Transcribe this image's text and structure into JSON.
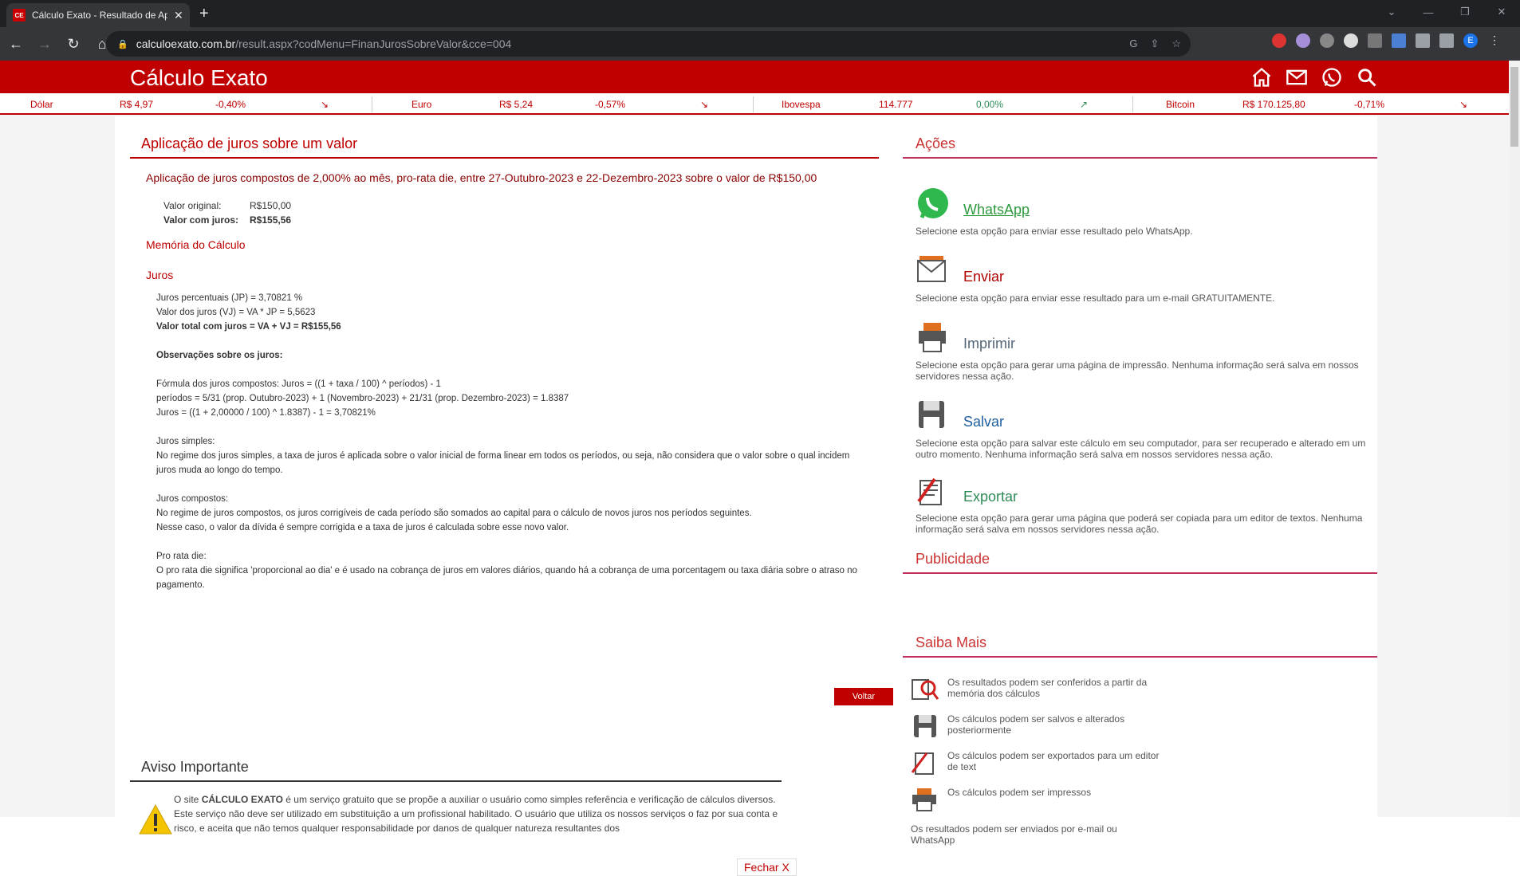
{
  "browser": {
    "tab_title": "Cálculo Exato - Resultado de Ap",
    "favicon_text": "CE",
    "url_host": "calculoexato.com.br",
    "url_path": "/result.aspx?codMenu=FinanJurosSobreValor&cce=004",
    "avatar_letter": "E"
  },
  "header": {
    "logo": "Cálculo Exato"
  },
  "ticker": [
    {
      "name": "Dólar",
      "price": "R$ 4,97",
      "change": "-0,40%",
      "trend": "down"
    },
    {
      "name": "Euro",
      "price": "R$ 5,24",
      "change": "-0,57%",
      "trend": "down"
    },
    {
      "name": "Ibovespa",
      "price": "114.777",
      "change": "0,00%",
      "trend": "up"
    },
    {
      "name": "Bitcoin",
      "price": "R$ 170.125,80",
      "change": "-0,71%",
      "trend": "down"
    }
  ],
  "main": {
    "title": "Aplicação de juros sobre um valor",
    "subtitle": "Aplicação de juros compostos de 2,000% ao mês, pro-rata die, entre 27-Outubro-2023 e 22-Dezembro-2023 sobre o valor de R$150,00",
    "valor_original_label": "Valor original:",
    "valor_original": "R$150,00",
    "valor_juros_label": "Valor com juros:",
    "valor_juros": "R$155,56",
    "memoria": "Memória do Cálculo",
    "juros_heading": "Juros",
    "lines": {
      "l1": "Juros percentuais (JP)  =  3,70821 %",
      "l2": "Valor dos juros (VJ)  =  VA * JP  =  5,5623",
      "l3": "Valor total com juros  =  VA + VJ  =  R$155,56",
      "obs": "Observações sobre os juros:",
      "f1": "Fórmula dos juros compostos: Juros = ((1 + taxa / 100) ^ períodos) - 1",
      "f2": "períodos = 5/31 (prop. Outubro-2023) + 1 (Novembro-2023) + 21/31 (prop. Dezembro-2023) = 1.8387",
      "f3": "Juros = ((1 + 2,00000 / 100) ^ 1.8387) - 1 = 3,70821%",
      "s_title": "Juros simples:",
      "s_body": "No regime dos juros simples, a taxa de juros é aplicada sobre o valor inicial de forma linear em todos os períodos, ou seja, não considera que o valor sobre o qual incidem juros muda ao longo do tempo.",
      "c_title": "Juros compostos:",
      "c_body1": "No regime de juros compostos, os juros corrigíveis de cada período são somados ao capital para o cálculo de novos juros nos períodos seguintes.",
      "c_body2": "Nesse caso, o valor da dívida é sempre corrigida e a taxa de juros é calculada sobre esse novo valor.",
      "p_title": "Pro rata die:",
      "p_body": "O pro rata die significa 'proporcional ao dia' e é usado na cobrança de juros em valores diários, quando há a cobrança de uma porcentagem ou taxa diária sobre o atraso no pagamento."
    },
    "voltar": "Voltar",
    "aviso_title": "Aviso Importante",
    "aviso_body_pre": "O site ",
    "aviso_body_bold": "CÁLCULO EXATO",
    "aviso_body_post": " é um serviço gratuito que se propõe a auxiliar o usuário como simples referência e verificação de cálculos diversos. Este serviço não deve ser utilizado em substituição a um profissional habilitado. O usuário que utiliza os nossos serviços o faz por sua conta e risco, e aceita que não temos qualquer responsabilidade por danos de qualquer natureza resultantes dos",
    "fechar": "Fechar X"
  },
  "sidebar": {
    "acoes_title": "Ações",
    "actions": [
      {
        "label": "WhatsApp",
        "desc": "Selecione esta opção para enviar esse resultado pelo WhatsApp.",
        "color": "#2e9a3e"
      },
      {
        "label": "Enviar",
        "desc": "Selecione esta opção para enviar esse resultado para um e-mail GRATUITAMENTE.",
        "color": "#b00000"
      },
      {
        "label": "Imprimir",
        "desc": "Selecione esta opção para gerar uma página de impressão. Nenhuma informação será salva em nossos servidores nessa ação.",
        "color": "#556677"
      },
      {
        "label": "Salvar",
        "desc": "Selecione esta opção para salvar este cálculo em seu computador, para ser recuperado e alterado em um outro momento. Nenhuma informação será salva em nossos servidores nessa ação.",
        "color": "#1f5fa0"
      },
      {
        "label": "Exportar",
        "desc": "Selecione esta opção para gerar uma página que poderá ser copiada para um editor de textos. Nenhuma informação será salva em nossos servidores nessa ação.",
        "color": "#2e8b57"
      }
    ],
    "publicidade_title": "Publicidade",
    "saiba_title": "Saiba Mais",
    "saiba": [
      "Os resultados podem ser conferidos a partir da memória dos cálculos",
      "Os cálculos podem ser salvos e alterados posteriormente",
      "Os cálculos podem ser exportados para um editor de text",
      "Os cálculos podem ser impressos",
      "Os resultados podem ser enviados por e-mail ou WhatsApp"
    ]
  }
}
